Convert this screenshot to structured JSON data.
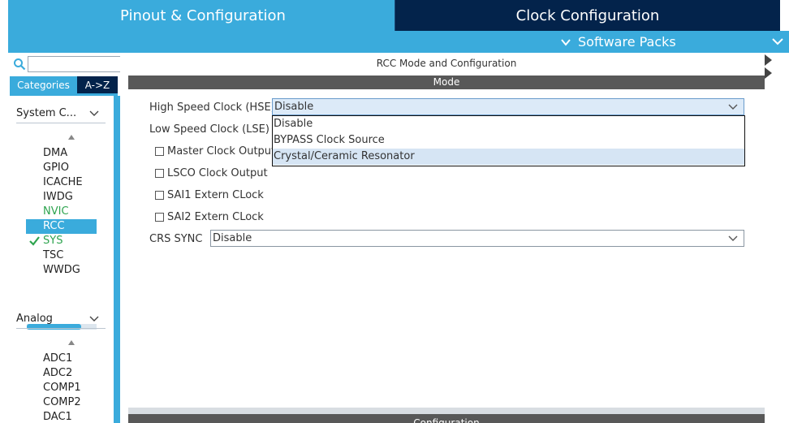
{
  "tabs": {
    "pinout": "Pinout & Configuration",
    "clock": "Clock Configuration"
  },
  "subbar": {
    "software_packs": "Software Packs"
  },
  "sidebar": {
    "search_value": "",
    "tab_categories": "Categories",
    "tab_az": "A->Z",
    "groups": [
      {
        "title": "System C...",
        "items": [
          "DMA",
          "GPIO",
          "ICACHE",
          "IWDG",
          "NVIC",
          "RCC",
          "SYS",
          "TSC",
          "WWDG"
        ]
      },
      {
        "title": "Analog",
        "items": [
          "ADC1",
          "ADC2",
          "COMP1",
          "COMP2",
          "DAC1"
        ]
      }
    ],
    "hscroll_fraction": 0.78
  },
  "main": {
    "title": "RCC Mode and Configuration",
    "mode_header": "Mode",
    "config_header": "Configuration",
    "hse_label": "High Speed Clock (HSE)",
    "hse_value": "Disable",
    "lse_label": "Low Speed Clock (LSE)",
    "checkboxes": [
      "Master Clock Output",
      "LSCO Clock Output",
      "SAI1 Extern CLock",
      "SAI2 Extern CLock"
    ],
    "crs_label": "CRS SYNC",
    "crs_value": "Disable",
    "hse_options": [
      "Disable",
      "BYPASS Clock Source",
      "Crystal/Ceramic Resonator"
    ],
    "hse_highlighted_option": "Crystal/Ceramic Resonator"
  },
  "colors": {
    "accent": "#3aabdc",
    "dark_navy": "#03234b",
    "header_gray": "#585858",
    "enabled_green": "#2ea44f"
  }
}
